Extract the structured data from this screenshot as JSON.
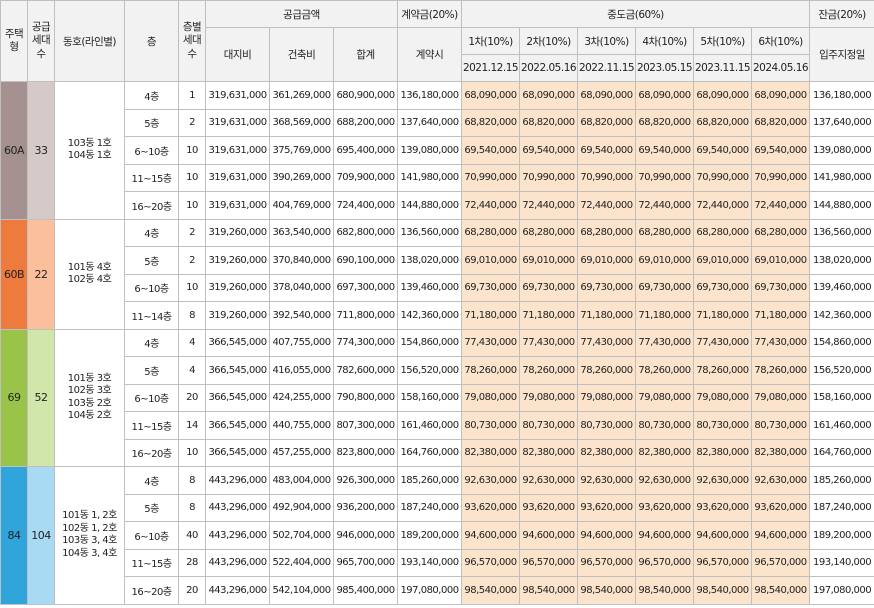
{
  "header": {
    "col_type": "주택형",
    "col_supply": "공급세대수",
    "col_dong": "동호(라인별)",
    "col_floor": "층",
    "col_floor_units": "층별세대수",
    "supply_amount": "공급금액",
    "land": "대지비",
    "building": "건축비",
    "total": "합계",
    "deposit": "계약금(20%)",
    "deposit_sub": "계약시",
    "middle": "중도금(60%)",
    "installments": [
      {
        "label": "1차(10%)",
        "date": "2021.12.15"
      },
      {
        "label": "2차(10%)",
        "date": "2022.05.16"
      },
      {
        "label": "3차(10%)",
        "date": "2022.11.15"
      },
      {
        "label": "4차(10%)",
        "date": "2023.05.15"
      },
      {
        "label": "5차(10%)",
        "date": "2023.11.15"
      },
      {
        "label": "6차(10%)",
        "date": "2024.05.16"
      }
    ],
    "balance": "잔금(20%)",
    "balance_sub": "입주지정일"
  },
  "colors": {
    "60A": {
      "type": "#a59290",
      "supply": "#d5cac8"
    },
    "60B": {
      "type": "#ee7a3e",
      "supply": "#fbbf9c"
    },
    "69": {
      "type": "#9ac449",
      "supply": "#d1e6aa"
    },
    "84": {
      "type": "#2fa5dc",
      "supply": "#a9daf3"
    },
    "middle_bg": "#fce4cc"
  },
  "groups": [
    {
      "type": "60A",
      "supply": "33",
      "dong": "103동 1호<br>104동 1호",
      "rows": [
        {
          "floor": "4층",
          "units": "1",
          "land": "319,631,000",
          "build": "361,269,000",
          "total": "680,900,000",
          "deposit": "136,180,000",
          "mid": "68,090,000",
          "balance": "136,180,000"
        },
        {
          "floor": "5층",
          "units": "2",
          "land": "319,631,000",
          "build": "368,569,000",
          "total": "688,200,000",
          "deposit": "137,640,000",
          "mid": "68,820,000",
          "balance": "137,640,000"
        },
        {
          "floor": "6~10층",
          "units": "10",
          "land": "319,631,000",
          "build": "375,769,000",
          "total": "695,400,000",
          "deposit": "139,080,000",
          "mid": "69,540,000",
          "balance": "139,080,000"
        },
        {
          "floor": "11~15층",
          "units": "10",
          "land": "319,631,000",
          "build": "390,269,000",
          "total": "709,900,000",
          "deposit": "141,980,000",
          "mid": "70,990,000",
          "balance": "141,980,000"
        },
        {
          "floor": "16~20층",
          "units": "10",
          "land": "319,631,000",
          "build": "404,769,000",
          "total": "724,400,000",
          "deposit": "144,880,000",
          "mid": "72,440,000",
          "balance": "144,880,000"
        }
      ]
    },
    {
      "type": "60B",
      "supply": "22",
      "dong": "101동 4호<br>102동 4호",
      "rows": [
        {
          "floor": "4층",
          "units": "2",
          "land": "319,260,000",
          "build": "363,540,000",
          "total": "682,800,000",
          "deposit": "136,560,000",
          "mid": "68,280,000",
          "balance": "136,560,000"
        },
        {
          "floor": "5층",
          "units": "2",
          "land": "319,260,000",
          "build": "370,840,000",
          "total": "690,100,000",
          "deposit": "138,020,000",
          "mid": "69,010,000",
          "balance": "138,020,000"
        },
        {
          "floor": "6~10층",
          "units": "10",
          "land": "319,260,000",
          "build": "378,040,000",
          "total": "697,300,000",
          "deposit": "139,460,000",
          "mid": "69,730,000",
          "balance": "139,460,000"
        },
        {
          "floor": "11~14층",
          "units": "8",
          "land": "319,260,000",
          "build": "392,540,000",
          "total": "711,800,000",
          "deposit": "142,360,000",
          "mid": "71,180,000",
          "balance": "142,360,000"
        }
      ]
    },
    {
      "type": "69",
      "supply": "52",
      "dong": "101동 3호<br>102동 3호<br>103동 2호<br>104동 2호",
      "rows": [
        {
          "floor": "4층",
          "units": "4",
          "land": "366,545,000",
          "build": "407,755,000",
          "total": "774,300,000",
          "deposit": "154,860,000",
          "mid": "77,430,000",
          "balance": "154,860,000"
        },
        {
          "floor": "5층",
          "units": "4",
          "land": "366,545,000",
          "build": "416,055,000",
          "total": "782,600,000",
          "deposit": "156,520,000",
          "mid": "78,260,000",
          "balance": "156,520,000"
        },
        {
          "floor": "6~10층",
          "units": "20",
          "land": "366,545,000",
          "build": "424,255,000",
          "total": "790,800,000",
          "deposit": "158,160,000",
          "mid": "79,080,000",
          "balance": "158,160,000"
        },
        {
          "floor": "11~15층",
          "units": "14",
          "land": "366,545,000",
          "build": "440,755,000",
          "total": "807,300,000",
          "deposit": "161,460,000",
          "mid": "80,730,000",
          "balance": "161,460,000"
        },
        {
          "floor": "16~20층",
          "units": "10",
          "land": "366,545,000",
          "build": "457,255,000",
          "total": "823,800,000",
          "deposit": "164,760,000",
          "mid": "82,380,000",
          "balance": "164,760,000"
        }
      ]
    },
    {
      "type": "84",
      "supply": "104",
      "dong": "101동 1, 2호<br>102동 1, 2호<br>103동 3, 4호<br>104동 3, 4호",
      "rows": [
        {
          "floor": "4층",
          "units": "8",
          "land": "443,296,000",
          "build": "483,004,000",
          "total": "926,300,000",
          "deposit": "185,260,000",
          "mid": "92,630,000",
          "balance": "185,260,000"
        },
        {
          "floor": "5층",
          "units": "8",
          "land": "443,296,000",
          "build": "492,904,000",
          "total": "936,200,000",
          "deposit": "187,240,000",
          "mid": "93,620,000",
          "balance": "187,240,000"
        },
        {
          "floor": "6~10층",
          "units": "40",
          "land": "443,296,000",
          "build": "502,704,000",
          "total": "946,000,000",
          "deposit": "189,200,000",
          "mid": "94,600,000",
          "balance": "189,200,000"
        },
        {
          "floor": "11~15층",
          "units": "28",
          "land": "443,296,000",
          "build": "522,404,000",
          "total": "965,700,000",
          "deposit": "193,140,000",
          "mid": "96,570,000",
          "balance": "193,140,000"
        },
        {
          "floor": "16~20층",
          "units": "20",
          "land": "443,296,000",
          "build": "542,104,000",
          "total": "985,400,000",
          "deposit": "197,080,000",
          "mid": "98,540,000",
          "balance": "197,080,000"
        }
      ]
    }
  ]
}
